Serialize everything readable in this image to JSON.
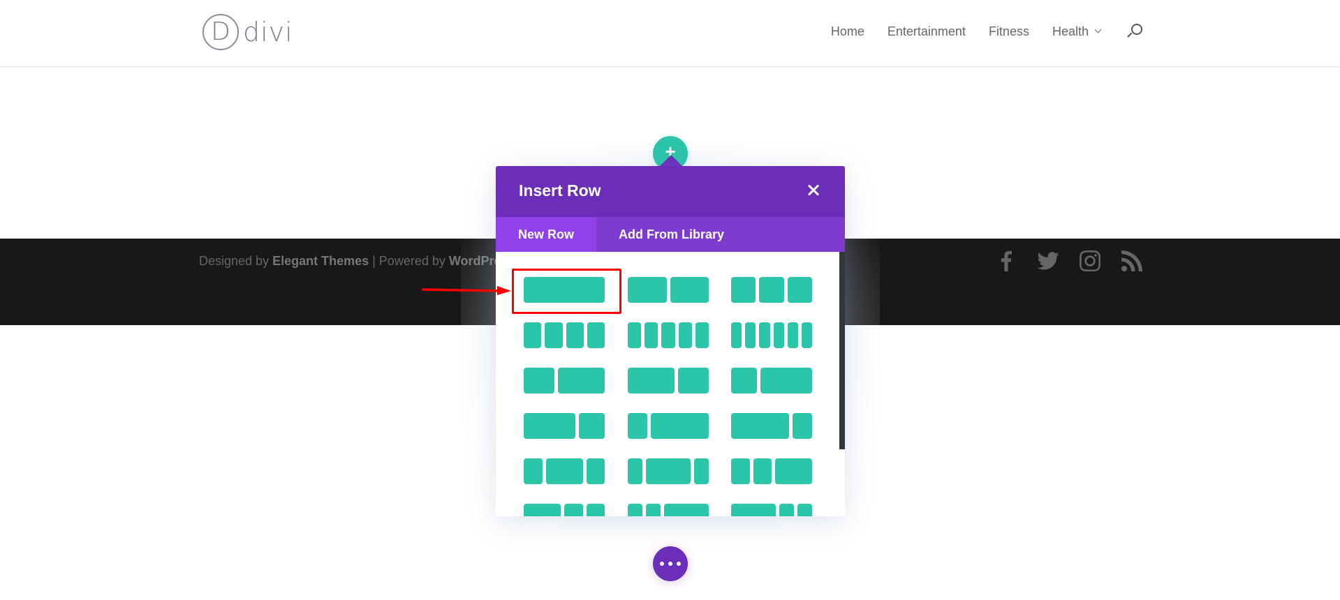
{
  "site": {
    "logo_letter": "D",
    "logo_text": "divi"
  },
  "nav": {
    "items": [
      {
        "label": "Home"
      },
      {
        "label": "Entertainment"
      },
      {
        "label": "Fitness"
      },
      {
        "label": "Health",
        "has_dropdown": true
      }
    ],
    "search_icon": "search-icon"
  },
  "footer": {
    "credits": {
      "prefix": "Designed by ",
      "brand": "Elegant Themes",
      "separator": " | Powered by ",
      "platform": "WordPress"
    },
    "social_icons": [
      "facebook-icon",
      "twitter-icon",
      "instagram-icon",
      "rss-icon"
    ]
  },
  "add_button": {
    "label": "+"
  },
  "modal": {
    "title": "Insert Row",
    "close_icon": "close-icon",
    "tabs": [
      {
        "label": "New Row",
        "active": true
      },
      {
        "label": "Add From Library",
        "active": false
      }
    ],
    "layouts": [
      {
        "name": "1",
        "columns": [
          1
        ]
      },
      {
        "name": "1/2 + 1/2",
        "columns": [
          1,
          1
        ]
      },
      {
        "name": "1/3 + 1/3 + 1/3",
        "columns": [
          1,
          1,
          1
        ]
      },
      {
        "name": "1/4 x 4",
        "columns": [
          1,
          1,
          1,
          1
        ]
      },
      {
        "name": "1/5 x 5",
        "columns": [
          1,
          1,
          1,
          1,
          1
        ]
      },
      {
        "name": "1/6 x 6",
        "columns": [
          1,
          1,
          1,
          1,
          1,
          1
        ]
      },
      {
        "name": "2/5 + 3/5",
        "columns": [
          2,
          3
        ]
      },
      {
        "name": "3/5 + 2/5",
        "columns": [
          3,
          2
        ]
      },
      {
        "name": "1/3 + 2/3",
        "columns": [
          1,
          2
        ]
      },
      {
        "name": "2/3 + 1/3",
        "columns": [
          2,
          1
        ]
      },
      {
        "name": "1/4 + 3/4",
        "columns": [
          1,
          3
        ]
      },
      {
        "name": "3/4 + 1/4",
        "columns": [
          3,
          1
        ]
      },
      {
        "name": "1/4 + 1/2 + 1/4",
        "columns": [
          1,
          2,
          1
        ]
      },
      {
        "name": "1/5 + 3/5 + 1/5",
        "columns": [
          1,
          3,
          1
        ]
      },
      {
        "name": "1/4 + 1/4 + 1/2",
        "columns": [
          1,
          1,
          2
        ]
      },
      {
        "name": "1/2 + 1/4 + 1/4",
        "columns": [
          2,
          1,
          1
        ]
      },
      {
        "name": "1/5 + 1/5 + 3/5",
        "columns": [
          1,
          1,
          3
        ]
      },
      {
        "name": "3/5 + 1/5 + 1/5",
        "columns": [
          3,
          1,
          1
        ]
      }
    ],
    "selected_layout_index": 0,
    "scroll_position": 0
  },
  "more_button": {
    "icon": "more-dots-icon"
  },
  "colors": {
    "accent_teal": "#2bc5aa",
    "modal_header": "#6c2eb9",
    "tab_bar": "#7d3bcf",
    "tab_active": "#8f42ec",
    "footer_bg": "#181818",
    "highlight_red": "#ff0000"
  }
}
